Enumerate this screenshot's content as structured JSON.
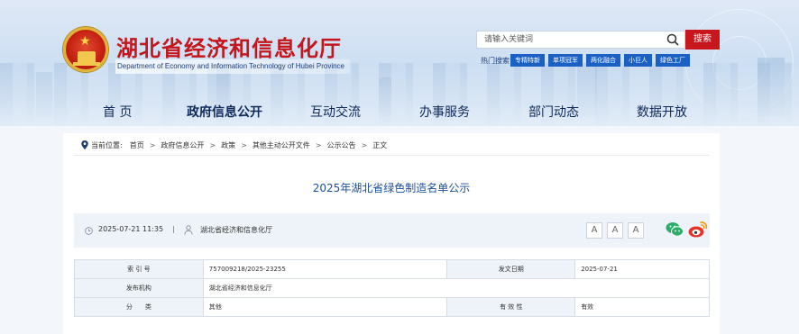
{
  "header": {
    "title": "湖北省经济和信息化厅",
    "subtitle": "Department of Economy and Information Technology of Hubei Province"
  },
  "search": {
    "placeholder": "请输入关键词",
    "button_label": "搜索",
    "hot_label": "热门搜索：",
    "hot_tags": [
      "专精特新",
      "单项冠军",
      "两化融合",
      "小巨人",
      "绿色工厂"
    ]
  },
  "nav": {
    "items": [
      "首 页",
      "政府信息公开",
      "互动交流",
      "办事服务",
      "部门动态",
      "数据开放"
    ],
    "active_index": 1
  },
  "breadcrumb": {
    "prefix": "当前位置:",
    "items": [
      "首页",
      "政府信息公开",
      "政策",
      "其他主动公开文件",
      "公示公告",
      "正文"
    ],
    "separator": ">"
  },
  "article": {
    "title": "2025年湖北省绿色制造名单公示",
    "date": "2025-07-21 11:35",
    "divider": "|",
    "source": "湖北省经济和信息化厅",
    "font_sizes": [
      "A",
      "A",
      "A"
    ]
  },
  "info_table": {
    "index_label": "索 引 号",
    "index_value": "757009218/2025-23255",
    "date_label": "发文日期",
    "date_value": "2025-07-21",
    "org_label": "发布机构",
    "org_value": "湖北省经济和信息化厅",
    "category_label": "分　　类",
    "category_value": "其他",
    "validity_label": "有 效 性",
    "validity_value": "有效"
  },
  "colors": {
    "brand_red": "#c4161c",
    "nav_text": "#0f2a5a",
    "title_blue": "#1a4f9c",
    "tag_blue": "#1b61c4",
    "wechat_green": "#2aae67",
    "weibo_orange": "#e6332a"
  },
  "icons": [
    "emblem-icon",
    "search-icon",
    "pin-icon",
    "clock-icon",
    "user-icon",
    "wechat-icon",
    "weibo-icon"
  ]
}
